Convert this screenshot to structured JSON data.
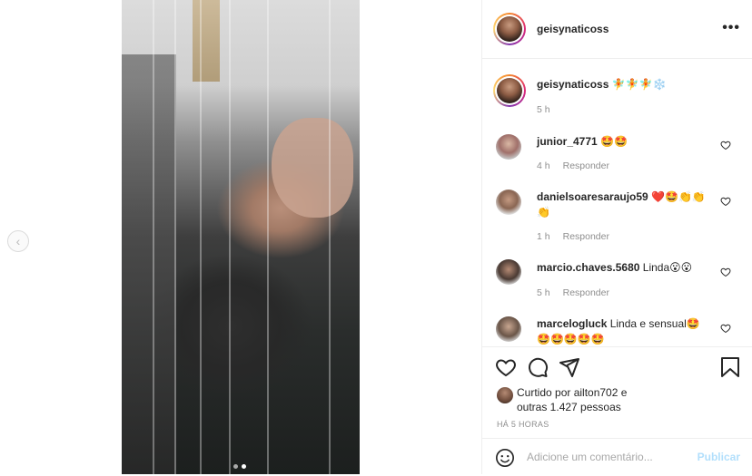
{
  "post": {
    "username": "geisynaticoss",
    "caption": "🧚🧚🧚❄️",
    "caption_time": "5 h",
    "more_label": "•••"
  },
  "comments": [
    {
      "username": "junior_4771",
      "text": "🤩🤩",
      "time": "4 h",
      "reply": "Responder"
    },
    {
      "username": "danielsoaresaraujo59",
      "text": "❤️🤩👏👏",
      "text2": "👏",
      "time": "1 h",
      "reply": "Responder"
    },
    {
      "username": "marcio.chaves.5680",
      "text": "Linda😮😮",
      "time": "5 h",
      "reply": "Responder"
    },
    {
      "username": "marcelogluck",
      "text": "Linda e sensual🤩",
      "text2": "🤩🤩🤩🤩🤩",
      "time": "",
      "reply": ""
    }
  ],
  "likes": {
    "line1": "Curtido por ailton702 e",
    "line2": "outras 1.427 pessoas"
  },
  "timestamp": "HÁ 5 HORAS",
  "comment_input": {
    "placeholder": "Adicione um comentário...",
    "publish_label": "Publicar"
  },
  "nav": {
    "prev_label": "‹"
  },
  "colors": {
    "link_blue": "#b2dffc",
    "muted": "#8e8e8e",
    "text": "#262626"
  },
  "icons": [
    "heart-icon",
    "comment-icon",
    "share-icon",
    "bookmark-icon",
    "emoji-icon",
    "more-icon",
    "chevron-left-icon"
  ]
}
